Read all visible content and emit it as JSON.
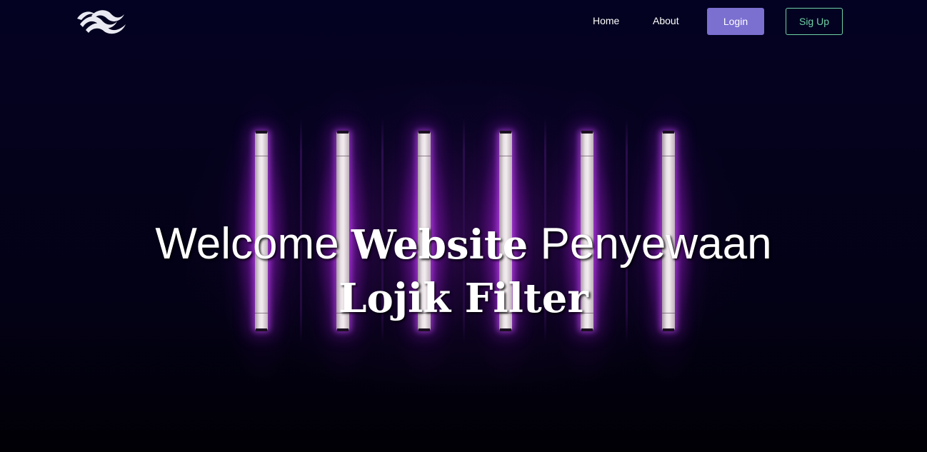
{
  "nav": {
    "logo_icon": "wave-stripes-logo-icon",
    "home_label": "Home",
    "about_label": "About",
    "login_label": "Login",
    "signup_label": "Sig Up"
  },
  "hero": {
    "line1_part1": "Welcome",
    "line1_part2": "Website",
    "line1_part3": "Penyewaan",
    "line2": "Lojik Filter"
  },
  "colors": {
    "login_bg": "#7b6fd0",
    "signup_border": "#6fd1a6",
    "background": "#02011a",
    "neon_glow": "#b628e8"
  }
}
